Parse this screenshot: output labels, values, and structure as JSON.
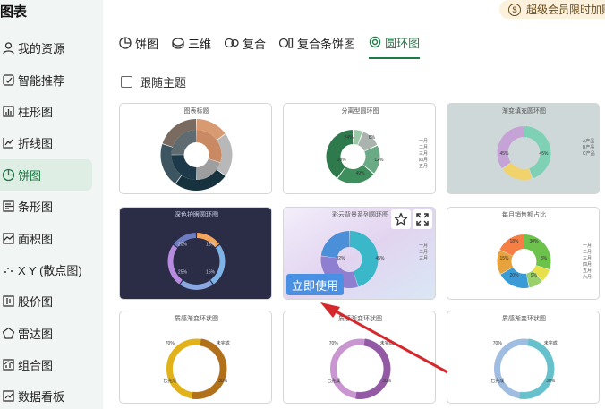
{
  "window": {
    "title": "图表"
  },
  "vip_banner": {
    "text": "超级会员限时加购"
  },
  "sidebar": {
    "items": [
      {
        "label": "我的资源",
        "icon": "resource-icon"
      },
      {
        "label": "智能推荐",
        "icon": "smart-icon"
      },
      {
        "label": "柱形图",
        "icon": "bar-chart-icon"
      },
      {
        "label": "折线图",
        "icon": "line-chart-icon"
      },
      {
        "label": "饼图",
        "icon": "pie-chart-icon",
        "active": true
      },
      {
        "label": "条形图",
        "icon": "hbar-chart-icon"
      },
      {
        "label": "面积图",
        "icon": "area-chart-icon"
      },
      {
        "label": "X Y (散点图)",
        "icon": "scatter-icon"
      },
      {
        "label": "股价图",
        "icon": "stock-icon"
      },
      {
        "label": "雷达图",
        "icon": "radar-icon"
      },
      {
        "label": "组合图",
        "icon": "combo-icon"
      },
      {
        "label": "数据看板",
        "icon": "dashboard-icon"
      }
    ]
  },
  "tabs": [
    {
      "label": "饼图"
    },
    {
      "label": "三维"
    },
    {
      "label": "复合"
    },
    {
      "label": "复合条饼图"
    },
    {
      "label": "圆环图",
      "active": true
    }
  ],
  "follow_theme": {
    "label": "跟随主题",
    "checked": false
  },
  "cards": [
    {
      "title": "图表标题",
      "theme": "light"
    },
    {
      "title": "分离型圆环图",
      "theme": "light",
      "labels": [
        "6%",
        "12%",
        "49%",
        "18%",
        "24%"
      ],
      "legend": [
        "一月",
        "二月",
        "三月",
        "四月",
        "五月"
      ]
    },
    {
      "title": "渐变填充圆环图",
      "theme": "gray",
      "labels": [
        "45%",
        "45%"
      ],
      "legend": [
        "A产品",
        "B产品",
        "C产品"
      ]
    },
    {
      "title": "深色护眼圆环图",
      "theme": "dark",
      "labels": [
        "15%",
        "15%",
        "25%",
        "20%"
      ]
    },
    {
      "title": "彩云背景系列圆环图",
      "theme": "pastel",
      "labels": [
        "45%",
        "32%"
      ],
      "legend": [
        "一月",
        "二月",
        "三月"
      ]
    },
    {
      "title": "每月销售额占比",
      "theme": "light",
      "labels": [
        "30%",
        "8%",
        "9%",
        "20%",
        "15%",
        "18%"
      ],
      "legend": [
        "一月",
        "二月",
        "三月",
        "四月",
        "五月",
        "六月"
      ]
    },
    {
      "title": "质感渐变环状图",
      "theme": "light",
      "labels": [
        "未完成",
        "30%",
        "已完成",
        "70%"
      ]
    },
    {
      "title": "质感渐变环状图",
      "theme": "light",
      "labels": [
        "未完成",
        "30%",
        "已完成",
        "70%"
      ]
    },
    {
      "title": "质感渐变环状图",
      "theme": "light",
      "labels": [
        "未完成",
        "30%",
        "已完成",
        "70%"
      ]
    }
  ],
  "hover": {
    "use_button": "立即使用",
    "star_icon": "star-icon",
    "expand_icon": "expand-icon"
  },
  "colors": {
    "accent": "#1e7a46",
    "use_button": "#4a90e2",
    "arrow": "#d6282c"
  }
}
